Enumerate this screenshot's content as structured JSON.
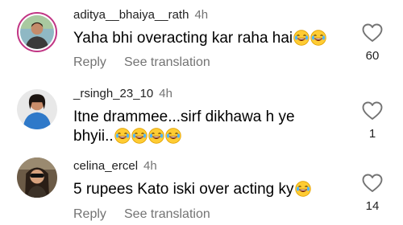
{
  "comments": [
    {
      "username": "aditya__bhaiya__rath",
      "time": "4h",
      "text": "Yaha bhi overacting kar raha hai",
      "emoji_count": 2,
      "reply_label": "Reply",
      "translate_label": "See translation",
      "likes": "60"
    },
    {
      "username": "_rsingh_23_10",
      "time": "4h",
      "text": "Itne drammee...sirf dikhawa h ye bhyii..",
      "emoji_count": 4,
      "likes": "1"
    },
    {
      "username": "celina_ercel",
      "time": "4h",
      "text": "5 rupees Kato iski over acting ky",
      "emoji_count": 1,
      "reply_label": "Reply",
      "translate_label": "See translation",
      "likes": "14"
    }
  ],
  "colors": {
    "ring": "#c13584",
    "muted": "#737373"
  },
  "icons": {
    "emoji": "face-with-tears-of-joy-icon",
    "like": "heart-outline-icon"
  }
}
